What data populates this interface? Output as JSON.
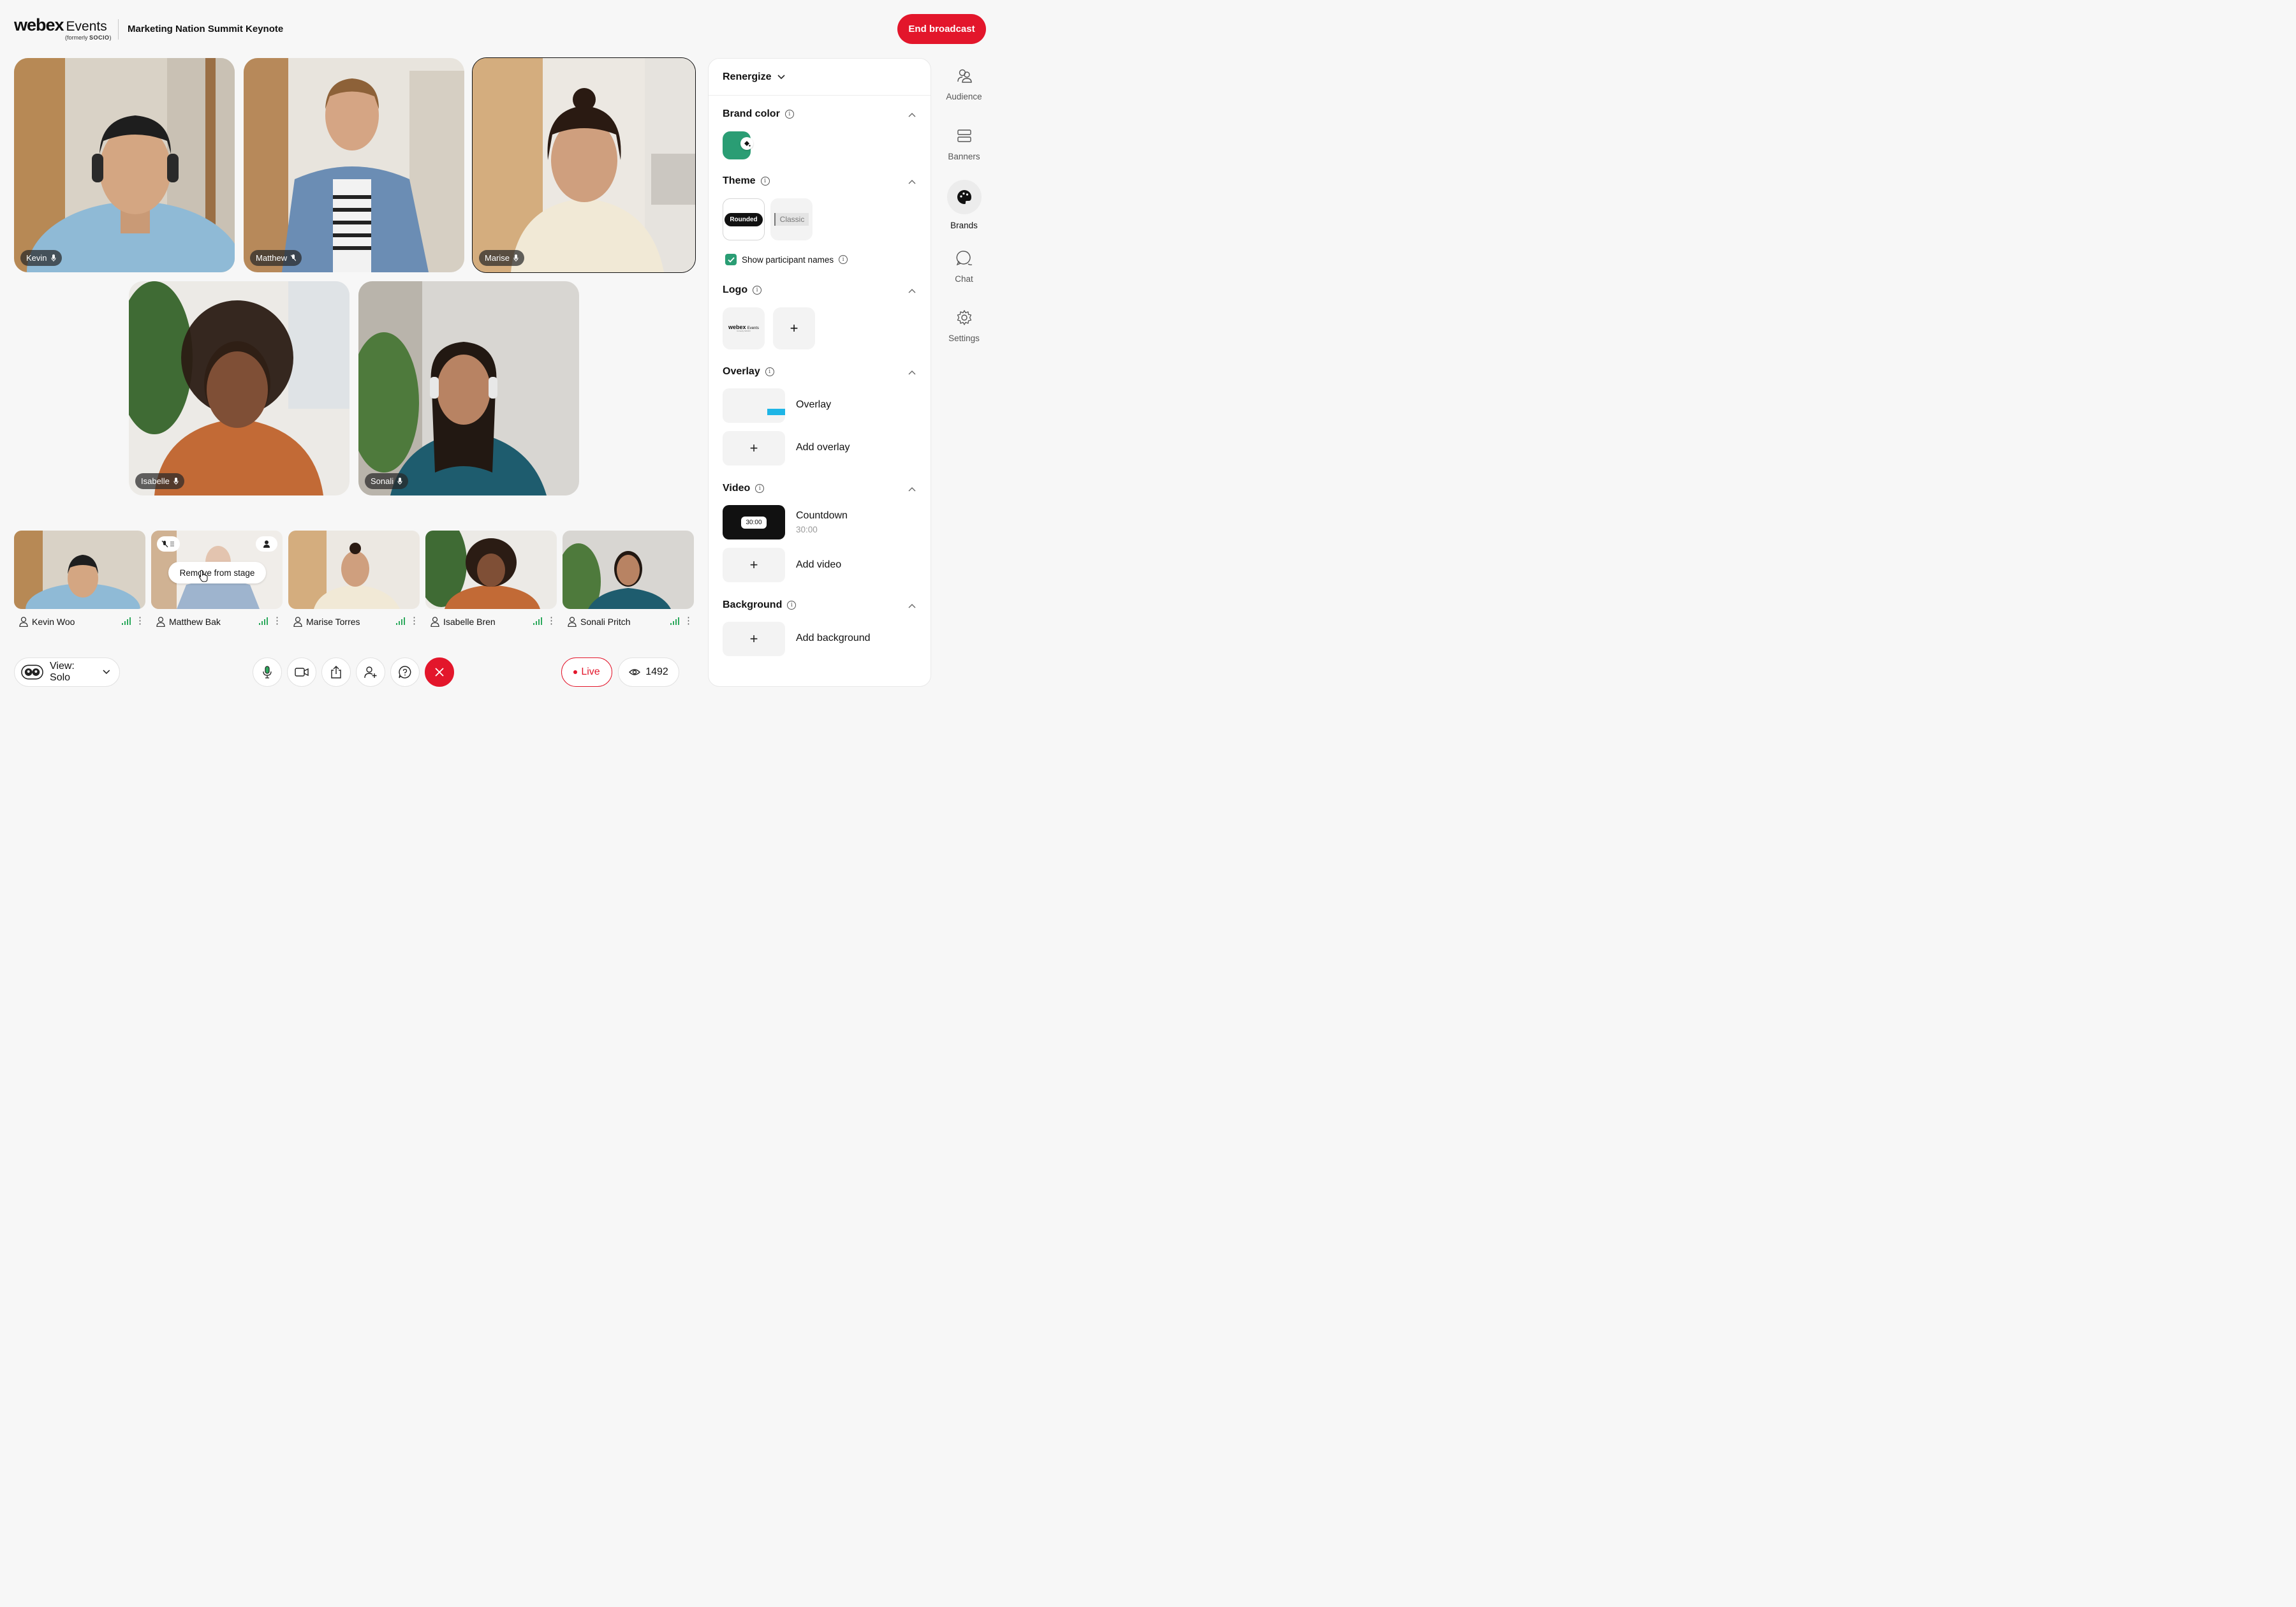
{
  "header": {
    "brand": "webex",
    "brand_suffix": "Events",
    "formerly_prefix": "(formerly ",
    "formerly_name": "SOCIO",
    "formerly_suffix": ")",
    "event_title": "Marketing Nation Summit Keynote",
    "end_button": "End broadcast"
  },
  "stage": {
    "tiles": [
      {
        "name": "Kevin",
        "active": false
      },
      {
        "name": "Matthew",
        "active": false,
        "muted": true
      },
      {
        "name": "Marise",
        "active": true
      },
      {
        "name": "Isabelle",
        "active": false
      },
      {
        "name": "Sonali",
        "active": false
      }
    ]
  },
  "backstage": {
    "participants": [
      {
        "name": "Kevin Woo"
      },
      {
        "name": "Matthew Bak"
      },
      {
        "name": "Marise Torres"
      },
      {
        "name": "Isabelle Bren"
      },
      {
        "name": "Sonali Pritch"
      }
    ],
    "hover_action": "Remove from stage"
  },
  "bottom_bar": {
    "view_label": "View: Solo",
    "controls": [
      "microphone-icon",
      "camera-icon",
      "share-icon",
      "add-person-icon",
      "qa-icon",
      "leave-icon"
    ],
    "live_label": "Live",
    "viewer_count": "1492"
  },
  "panel": {
    "brand_name": "Renergize",
    "brand_color": {
      "title": "Brand color",
      "value": "#2a9d74"
    },
    "theme": {
      "title": "Theme",
      "options": [
        "Rounded",
        "Classic"
      ],
      "selected": "Rounded"
    },
    "show_names": {
      "label": "Show participant names",
      "checked": true
    },
    "logo": {
      "title": "Logo",
      "thumb_brand": "webex",
      "thumb_suffix": "Events",
      "thumb_formerly": "formerly SOCIO"
    },
    "overlay": {
      "title": "Overlay",
      "item_label": "Overlay",
      "add_label": "Add overlay"
    },
    "video": {
      "title": "Video",
      "countdown_chip": "30:00",
      "countdown_label": "Countdown",
      "countdown_time": "30:00",
      "add_label": "Add video"
    },
    "background": {
      "title": "Background",
      "add_label": "Add background"
    }
  },
  "rail": {
    "items": [
      {
        "label": "Audience",
        "icon": "audience-icon"
      },
      {
        "label": "Banners",
        "icon": "banners-icon"
      },
      {
        "label": "Brands",
        "icon": "palette-icon",
        "active": true
      },
      {
        "label": "Chat",
        "icon": "chat-icon"
      },
      {
        "label": "Settings",
        "icon": "gear-icon"
      }
    ]
  },
  "colors": {
    "accent_red": "#e3162b",
    "brand_green": "#2a9d74",
    "signal_green": "#2eaa5e"
  }
}
